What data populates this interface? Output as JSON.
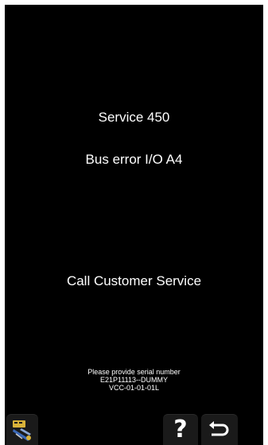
{
  "screen": {
    "service_title": "Service 450",
    "error_text": "Bus error I/O A4",
    "call_text": "Call Customer Service",
    "info_lines": [
      "Please provide serial number",
      "E21P11113--DUMMY",
      "VCC-01-01-01L"
    ]
  },
  "buttons": {
    "service_icon": "service-tools-icon",
    "help_icon": "question-mark-icon",
    "help_label": "?",
    "back_icon": "return-arrow-icon"
  },
  "colors": {
    "screen_background": "#000000",
    "text": "#ffffff",
    "service_icon_yellow": "#d8b23a",
    "service_icon_blue": "#3b69b8"
  }
}
